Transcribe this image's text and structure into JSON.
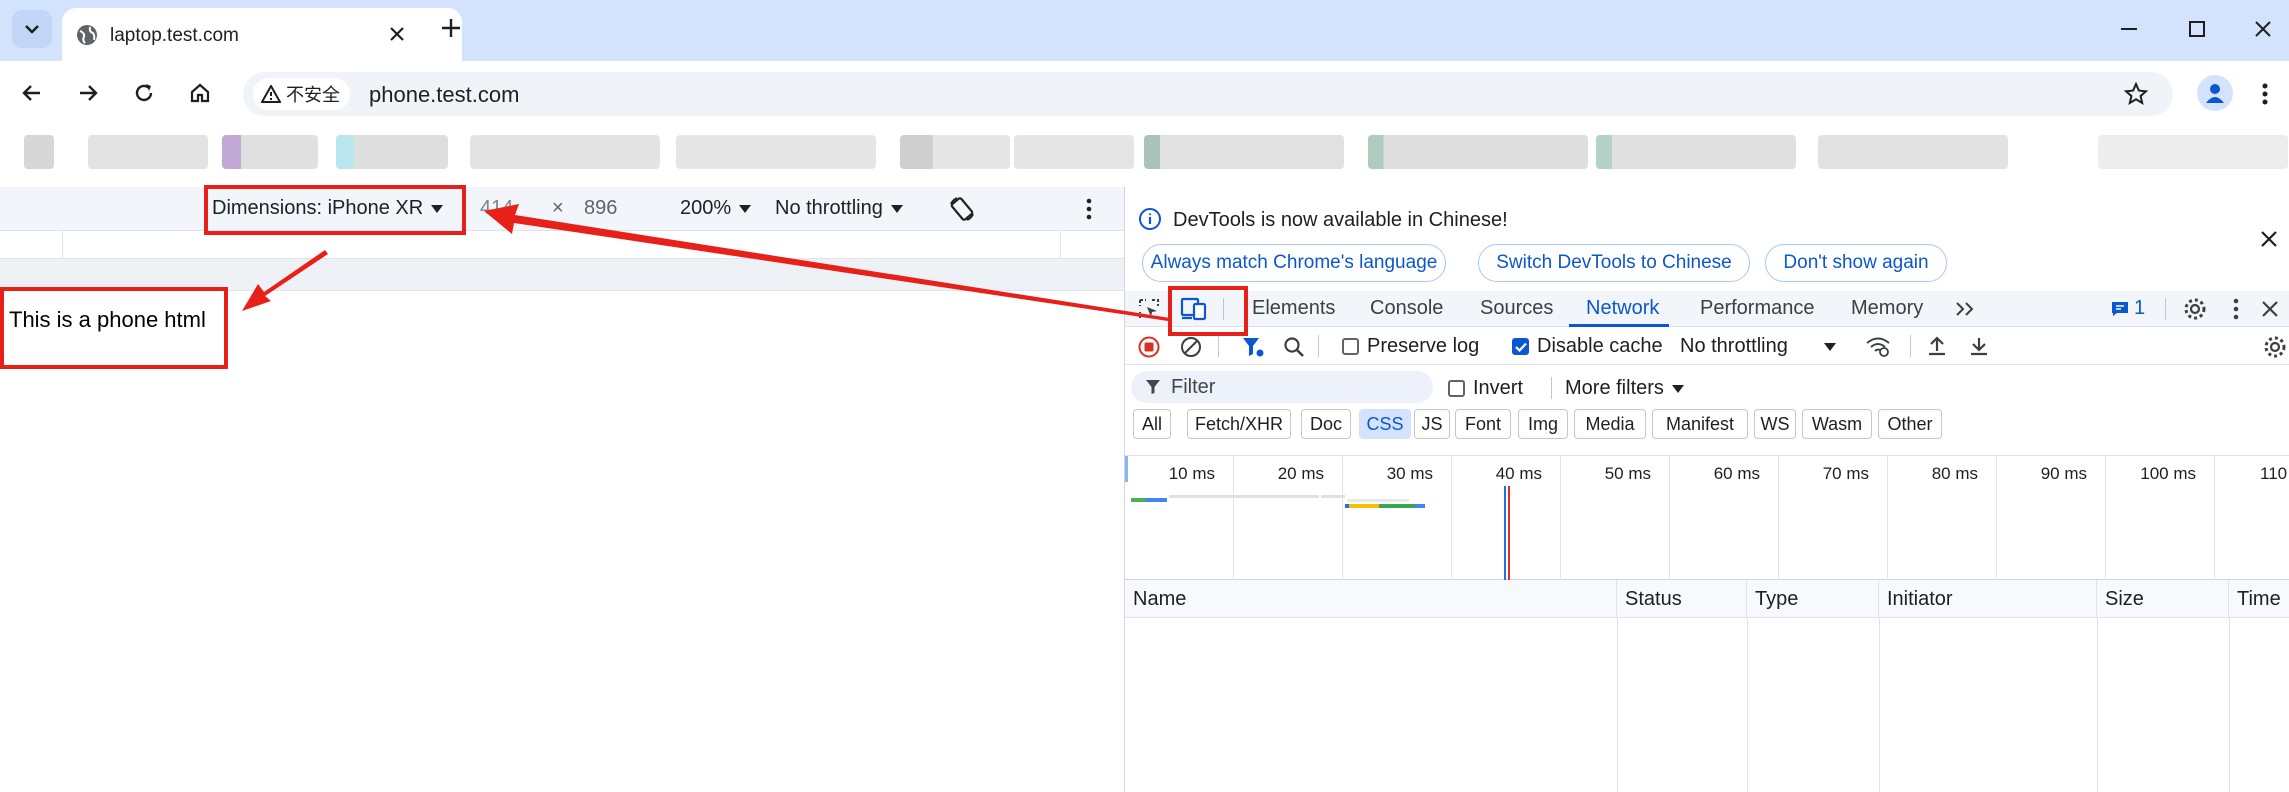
{
  "browser": {
    "tab_title": "laptop.test.com",
    "security_label": "不安全",
    "url": "phone.test.com"
  },
  "device_toolbar": {
    "dimensions_label": "Dimensions: iPhone XR",
    "width": "414",
    "separator": "×",
    "height": "896",
    "zoom": "200%",
    "throttling": "No throttling"
  },
  "page": {
    "text": "This is a phone html"
  },
  "devtools": {
    "banner": {
      "message": "DevTools is now available in Chinese!",
      "buttons": [
        "Always match Chrome's language",
        "Switch DevTools to Chinese",
        "Don't show again"
      ]
    },
    "tabs": [
      "Elements",
      "Console",
      "Sources",
      "Network",
      "Performance",
      "Memory"
    ],
    "active_tab": "Network",
    "issues_count": "1",
    "network_toolbar": {
      "preserve_log": "Preserve log",
      "preserve_log_checked": false,
      "disable_cache": "Disable cache",
      "disable_cache_checked": true,
      "throttling": "No throttling"
    },
    "filter": {
      "placeholder": "Filter",
      "invert": "Invert",
      "more_filters": "More filters"
    },
    "type_filters": [
      "All",
      "Fetch/XHR",
      "Doc",
      "CSS",
      "JS",
      "Font",
      "Img",
      "Media",
      "Manifest",
      "WS",
      "Wasm",
      "Other"
    ],
    "selected_type_filter": "CSS",
    "timeline_ticks": [
      "10 ms",
      "20 ms",
      "30 ms",
      "40 ms",
      "50 ms",
      "60 ms",
      "70 ms",
      "80 ms",
      "90 ms",
      "100 ms",
      "110"
    ],
    "columns": [
      "Name",
      "Status",
      "Type",
      "Initiator",
      "Size",
      "Time"
    ]
  },
  "colors": {
    "annotation_red": "#e8201a",
    "accent_blue": "#0b57d0",
    "tabstrip": "#d3e3fd"
  }
}
